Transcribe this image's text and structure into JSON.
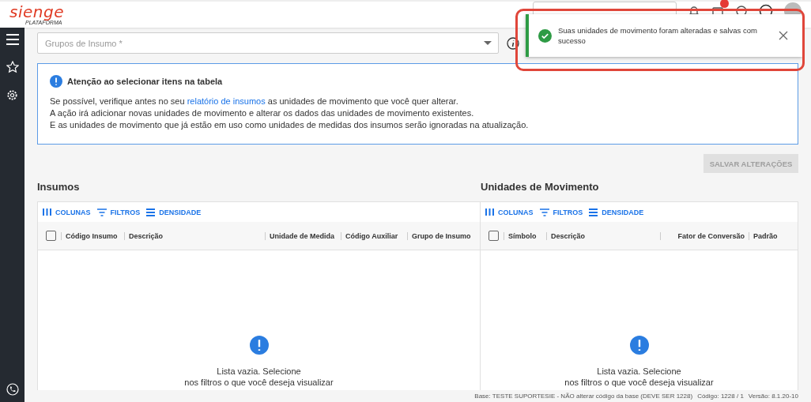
{
  "header": {
    "logo": "sienge",
    "logo_sub": "PLATAFORMA",
    "notification_badge": true
  },
  "toast": {
    "message": "Suas unidades de movimento foram alteradas e salvas com sucesso",
    "kind": "success"
  },
  "filter": {
    "placeholder": "Grupos de Insumo *"
  },
  "alert": {
    "title": "Atenção ao selecionar itens na tabela",
    "lines": [
      "Se possível, verifique antes no seu **relatório de insumos** as unidades de movimento que você quer alterar.",
      "A ação irá adicionar novas unidades de movimento e alterar os dados das unidades de movimento existentes.",
      "E as unidades de movimento que já estão em uso como unidades de medidas dos insumos serão ignoradas na atualização."
    ]
  },
  "save_button": {
    "label": "SALVAR ALTERAÇÕES",
    "disabled": true
  },
  "tables": [
    {
      "title": "Insumos",
      "select_all_checked": false,
      "toolbar": [
        "COLUNAS",
        "FILTROS",
        "DENSIDADE"
      ],
      "columns": [
        "Código Insumo",
        "Descrição",
        "Unidade de Medida",
        "Código Auxiliar",
        "Grupo de Insumo"
      ],
      "empty": [
        "Lista vazia. Selecione",
        "nos filtros o que você deseja visualizar"
      ]
    },
    {
      "title": "Unidades de Movimento",
      "select_all_checked": false,
      "toolbar": [
        "COLUNAS",
        "FILTROS",
        "DENSIDADE"
      ],
      "columns": [
        "Símbolo",
        "Descrição",
        "Fator de Conversão",
        "Padrão"
      ],
      "empty": [
        "Lista vazia. Selecione",
        "nos filtros o que você deseja visualizar"
      ]
    }
  ],
  "status_bar": [
    "Base: TESTE SUPORTESIE - NÃO alterar código da base (DEVE SER 1228)",
    "Código: 1228 / 1",
    "Versão: 8.1.20-10"
  ]
}
